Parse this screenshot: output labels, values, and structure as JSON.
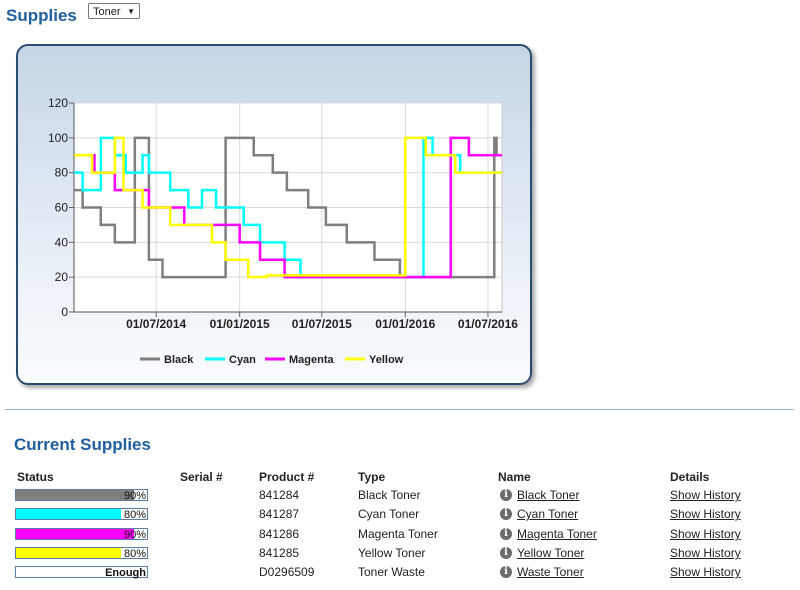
{
  "header": {
    "title": "Supplies",
    "select_value": "Toner"
  },
  "chart_data": {
    "type": "line",
    "step": true,
    "x_range": [
      "2014-01-01",
      "2016-08-01"
    ],
    "ylim": [
      0,
      120
    ],
    "y_ticks": [
      0,
      20,
      40,
      60,
      80,
      100,
      120
    ],
    "x_ticks": [
      "01/07/2014",
      "01/01/2015",
      "01/07/2015",
      "01/01/2016",
      "01/07/2016"
    ],
    "grid": true,
    "legend_position": "bottom",
    "series": [
      {
        "name": "Black",
        "color": "#7f7f7f",
        "points": [
          [
            "2014-01-01",
            70
          ],
          [
            "2014-01-20",
            60
          ],
          [
            "2014-03-01",
            50
          ],
          [
            "2014-04-01",
            40
          ],
          [
            "2014-05-15",
            100
          ],
          [
            "2014-06-15",
            30
          ],
          [
            "2014-07-15",
            20
          ],
          [
            "2014-12-01",
            100
          ],
          [
            "2015-02-01",
            90
          ],
          [
            "2015-03-15",
            80
          ],
          [
            "2015-04-15",
            70
          ],
          [
            "2015-06-01",
            60
          ],
          [
            "2015-07-10",
            50
          ],
          [
            "2015-08-25",
            40
          ],
          [
            "2015-10-25",
            30
          ],
          [
            "2015-12-20",
            20
          ],
          [
            "2016-07-15",
            100
          ],
          [
            "2016-07-20",
            90
          ],
          [
            "2016-08-01",
            90
          ]
        ]
      },
      {
        "name": "Cyan",
        "color": "#00ffff",
        "points": [
          [
            "2014-01-01",
            80
          ],
          [
            "2014-01-20",
            70
          ],
          [
            "2014-03-01",
            100
          ],
          [
            "2014-04-01",
            90
          ],
          [
            "2014-04-25",
            80
          ],
          [
            "2014-06-01",
            90
          ],
          [
            "2014-06-15",
            80
          ],
          [
            "2014-08-01",
            70
          ],
          [
            "2014-09-10",
            60
          ],
          [
            "2014-10-10",
            70
          ],
          [
            "2014-11-10",
            60
          ],
          [
            "2015-01-10",
            50
          ],
          [
            "2015-02-15",
            40
          ],
          [
            "2015-04-10",
            30
          ],
          [
            "2015-05-15",
            20
          ],
          [
            "2016-02-10",
            100
          ],
          [
            "2016-03-01",
            90
          ],
          [
            "2016-05-01",
            80
          ],
          [
            "2016-08-01",
            80
          ]
        ]
      },
      {
        "name": "Magenta",
        "color": "#ff00ff",
        "points": [
          [
            "2014-01-01",
            90
          ],
          [
            "2014-02-15",
            80
          ],
          [
            "2014-04-01",
            70
          ],
          [
            "2014-06-15",
            60
          ],
          [
            "2014-09-01",
            50
          ],
          [
            "2015-01-01",
            40
          ],
          [
            "2015-02-15",
            30
          ],
          [
            "2015-04-10",
            20
          ],
          [
            "2016-04-10",
            100
          ],
          [
            "2016-05-20",
            90
          ],
          [
            "2016-08-01",
            90
          ]
        ]
      },
      {
        "name": "Yellow",
        "color": "#ffff00",
        "points": [
          [
            "2014-01-01",
            90
          ],
          [
            "2014-02-10",
            80
          ],
          [
            "2014-04-01",
            100
          ],
          [
            "2014-04-20",
            70
          ],
          [
            "2014-06-01",
            60
          ],
          [
            "2014-08-01",
            50
          ],
          [
            "2014-11-01",
            40
          ],
          [
            "2014-12-01",
            30
          ],
          [
            "2015-01-20",
            20
          ],
          [
            "2015-03-01",
            21
          ],
          [
            "2016-01-01",
            100
          ],
          [
            "2016-02-15",
            90
          ],
          [
            "2016-04-20",
            80
          ],
          [
            "2016-08-01",
            80
          ]
        ]
      }
    ]
  },
  "current": {
    "title": "Current Supplies",
    "headers": {
      "status": "Status",
      "serial": "Serial #",
      "product": "Product #",
      "type": "Type",
      "name": "Name",
      "details": "Details"
    },
    "rows": [
      {
        "status_text": "90%",
        "level": 0.9,
        "color": "#7f7f7f",
        "serial": "",
        "product": "841284",
        "type": "Black Toner",
        "name": "Black Toner",
        "details": "Show History"
      },
      {
        "status_text": "80%",
        "level": 0.8,
        "color": "#00ffff",
        "serial": "",
        "product": "841287",
        "type": "Cyan Toner",
        "name": "Cyan Toner",
        "details": "Show History"
      },
      {
        "status_text": "90%",
        "level": 0.9,
        "color": "#ff00ff",
        "serial": "",
        "product": "841286",
        "type": "Magenta Toner",
        "name": "Magenta Toner",
        "details": "Show History"
      },
      {
        "status_text": "80%",
        "level": 0.8,
        "color": "#ffff00",
        "serial": "",
        "product": "841285",
        "type": "Yellow Toner",
        "name": "Yellow Toner",
        "details": "Show History"
      },
      {
        "status_text": "Enough",
        "level": 0,
        "color": "#ffffff",
        "serial": "",
        "product": "D0296509",
        "type": "Toner Waste",
        "name": "Waste Toner",
        "details": "Show History"
      }
    ]
  }
}
